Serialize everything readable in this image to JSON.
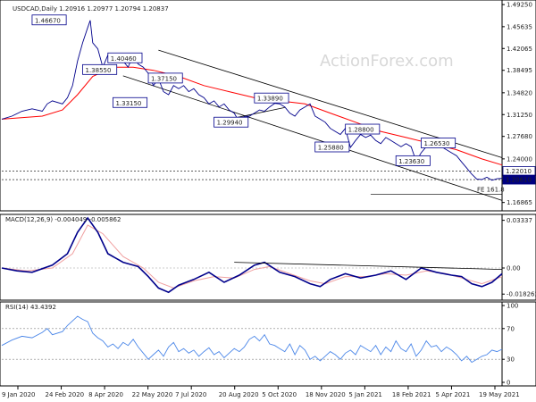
{
  "chart_data": [
    {
      "type": "line",
      "title": "USDCAD,Daily  1.20916 1.20977 1.20794 1.20837",
      "watermark": "ActionForex.com",
      "ylim": [
        1.155,
        1.5
      ],
      "y_ticks": [
        "1.49250",
        "1.45635",
        "1.42065",
        "1.38495",
        "1.34820",
        "1.31250",
        "1.27680",
        "1.24000",
        "1.20430",
        "1.16865"
      ],
      "x_labels": [
        "9 Jan 2020",
        "24 Feb 2020",
        "8 Apr 2020",
        "22 May 2020",
        "7 Jul 2020",
        "20 Aug 2020",
        "5 Oct 2020",
        "18 Nov 2020",
        "5 Jan 2021",
        "18 Feb 2021",
        "5 Apr 2021",
        "19 May 2021"
      ],
      "colors": {
        "price": "#00008b",
        "ma": "#ff0000",
        "channel": "#000000",
        "label_border": "#00008b",
        "label_fill": "#ffffff"
      },
      "price_series": [
        [
          0,
          1.305
        ],
        [
          2,
          1.31
        ],
        [
          4,
          1.318
        ],
        [
          6,
          1.322
        ],
        [
          8,
          1.318
        ],
        [
          9,
          1.33
        ],
        [
          10,
          1.335
        ],
        [
          12,
          1.33
        ],
        [
          13,
          1.34
        ],
        [
          14,
          1.36
        ],
        [
          15,
          1.4
        ],
        [
          16,
          1.43
        ],
        [
          17,
          1.455
        ],
        [
          17.5,
          1.4667
        ],
        [
          18,
          1.43
        ],
        [
          19,
          1.42
        ],
        [
          20,
          1.39
        ],
        [
          21,
          1.41
        ],
        [
          22,
          1.4
        ],
        [
          23,
          1.405
        ],
        [
          24,
          1.4
        ],
        [
          25,
          1.39
        ],
        [
          26,
          1.41
        ],
        [
          27,
          1.395
        ],
        [
          28,
          1.39
        ],
        [
          29,
          1.38
        ],
        [
          30,
          1.36
        ],
        [
          31,
          1.3715
        ],
        [
          32,
          1.35
        ],
        [
          33,
          1.345
        ],
        [
          34,
          1.36
        ],
        [
          35,
          1.355
        ],
        [
          36,
          1.36
        ],
        [
          37,
          1.35
        ],
        [
          38,
          1.355
        ],
        [
          39,
          1.345
        ],
        [
          40,
          1.34
        ],
        [
          41,
          1.33
        ],
        [
          42,
          1.335
        ],
        [
          43,
          1.325
        ],
        [
          44,
          1.33
        ],
        [
          45,
          1.32
        ],
        [
          46,
          1.315
        ],
        [
          47,
          1.3
        ],
        [
          48,
          1.3094
        ],
        [
          49,
          1.31
        ],
        [
          50,
          1.315
        ],
        [
          51,
          1.32
        ],
        [
          52,
          1.318
        ],
        [
          53,
          1.325
        ],
        [
          54,
          1.3309
        ],
        [
          55,
          1.33
        ],
        [
          56,
          1.325
        ],
        [
          57,
          1.315
        ],
        [
          58,
          1.31
        ],
        [
          59,
          1.32
        ],
        [
          60,
          1.325
        ],
        [
          61,
          1.33
        ],
        [
          62,
          1.31
        ],
        [
          63,
          1.305
        ],
        [
          64,
          1.3
        ],
        [
          65,
          1.29
        ],
        [
          66,
          1.285
        ],
        [
          67,
          1.28
        ],
        [
          68,
          1.29
        ],
        [
          69,
          1.2588
        ],
        [
          70,
          1.27
        ],
        [
          71,
          1.28
        ],
        [
          72,
          1.275
        ],
        [
          73,
          1.279
        ],
        [
          74,
          1.27
        ],
        [
          75,
          1.265
        ],
        [
          76,
          1.275
        ],
        [
          77,
          1.27
        ],
        [
          78,
          1.265
        ],
        [
          79,
          1.26
        ],
        [
          80,
          1.265
        ],
        [
          81,
          1.26
        ],
        [
          82,
          1.2363
        ],
        [
          83,
          1.25
        ],
        [
          84,
          1.26
        ],
        [
          85,
          1.27
        ],
        [
          86,
          1.2653
        ],
        [
          87,
          1.26
        ],
        [
          88,
          1.255
        ],
        [
          89,
          1.25
        ],
        [
          90,
          1.245
        ],
        [
          91,
          1.235
        ],
        [
          92,
          1.225
        ],
        [
          93,
          1.215
        ],
        [
          94,
          1.207
        ],
        [
          95,
          1.2061
        ],
        [
          96,
          1.21
        ],
        [
          97,
          1.205
        ],
        [
          98,
          1.2075
        ],
        [
          99,
          1.208
        ]
      ],
      "ma_series": [
        [
          0,
          1.305
        ],
        [
          8,
          1.31
        ],
        [
          12,
          1.32
        ],
        [
          15,
          1.345
        ],
        [
          18,
          1.375
        ],
        [
          22,
          1.39
        ],
        [
          26,
          1.39
        ],
        [
          30,
          1.385
        ],
        [
          35,
          1.375
        ],
        [
          40,
          1.36
        ],
        [
          45,
          1.35
        ],
        [
          50,
          1.34
        ],
        [
          55,
          1.335
        ],
        [
          60,
          1.33
        ],
        [
          65,
          1.315
        ],
        [
          70,
          1.3
        ],
        [
          75,
          1.285
        ],
        [
          80,
          1.275
        ],
        [
          85,
          1.265
        ],
        [
          90,
          1.255
        ],
        [
          95,
          1.24
        ],
        [
          99,
          1.23
        ]
      ],
      "horizontal_lines": [
        1.2201,
        1.2061
      ],
      "fe_line": {
        "value": 1.182,
        "label": "FE 161.8"
      },
      "price_labels": [
        {
          "text": "1.46670",
          "x": 6,
          "y": 1.4667
        },
        {
          "text": "1.38550",
          "x": 16,
          "y": 1.3855
        },
        {
          "text": "1.40460",
          "x": 21,
          "y": 1.4046
        },
        {
          "text": "1.37150",
          "x": 29,
          "y": 1.3715
        },
        {
          "text": "1.33150",
          "x": 22,
          "y": 1.3315
        },
        {
          "text": "1.29940",
          "x": 42,
          "y": 1.2994
        },
        {
          "text": "1.33890",
          "x": 50,
          "y": 1.3389
        },
        {
          "text": "1.28800",
          "x": 68,
          "y": 1.288
        },
        {
          "text": "1.25880",
          "x": 62,
          "y": 1.2588
        },
        {
          "text": "1.23630",
          "x": 78,
          "y": 1.2363
        },
        {
          "text": "1.26530",
          "x": 83,
          "y": 1.2653
        }
      ],
      "current_labels": [
        "1.22010",
        "1.20610"
      ]
    },
    {
      "type": "line",
      "title": "MACD(12,26,9) -0.004049 -0.005862",
      "ylim": [
        -0.02,
        0.035
      ],
      "y_ticks": [
        "0.03337",
        "0.00",
        "-0.018262"
      ],
      "macd_series": [
        [
          0,
          0.0
        ],
        [
          3,
          -0.002
        ],
        [
          6,
          -0.003
        ],
        [
          10,
          0.002
        ],
        [
          13,
          0.01
        ],
        [
          15,
          0.025
        ],
        [
          17,
          0.035
        ],
        [
          19,
          0.025
        ],
        [
          21,
          0.01
        ],
        [
          24,
          0.004
        ],
        [
          27,
          0.001
        ],
        [
          29,
          -0.006
        ],
        [
          31,
          -0.014
        ],
        [
          33,
          -0.017
        ],
        [
          35,
          -0.012
        ],
        [
          38,
          -0.008
        ],
        [
          41,
          -0.003
        ],
        [
          44,
          -0.01
        ],
        [
          47,
          -0.005
        ],
        [
          50,
          0.002
        ],
        [
          52,
          0.004
        ],
        [
          55,
          -0.003
        ],
        [
          58,
          -0.006
        ],
        [
          61,
          -0.011
        ],
        [
          63,
          -0.013
        ],
        [
          65,
          -0.008
        ],
        [
          68,
          -0.004
        ],
        [
          71,
          -0.007
        ],
        [
          74,
          -0.005
        ],
        [
          77,
          -0.002
        ],
        [
          80,
          -0.008
        ],
        [
          83,
          0.0
        ],
        [
          86,
          -0.003
        ],
        [
          89,
          -0.005
        ],
        [
          91,
          -0.006
        ],
        [
          93,
          -0.011
        ],
        [
          95,
          -0.013
        ],
        [
          97,
          -0.01
        ],
        [
          99,
          -0.004
        ]
      ],
      "signal_series": [
        [
          0,
          0.0
        ],
        [
          5,
          -0.002
        ],
        [
          10,
          0.0
        ],
        [
          14,
          0.01
        ],
        [
          17,
          0.03
        ],
        [
          20,
          0.024
        ],
        [
          24,
          0.008
        ],
        [
          28,
          0.0
        ],
        [
          31,
          -0.01
        ],
        [
          34,
          -0.014
        ],
        [
          38,
          -0.009
        ],
        [
          42,
          -0.006
        ],
        [
          46,
          -0.007
        ],
        [
          50,
          -0.001
        ],
        [
          53,
          0.001
        ],
        [
          57,
          -0.004
        ],
        [
          61,
          -0.009
        ],
        [
          64,
          -0.011
        ],
        [
          68,
          -0.006
        ],
        [
          72,
          -0.006
        ],
        [
          76,
          -0.004
        ],
        [
          80,
          -0.005
        ],
        [
          84,
          -0.002
        ],
        [
          88,
          -0.004
        ],
        [
          92,
          -0.008
        ],
        [
          95,
          -0.011
        ],
        [
          99,
          -0.006
        ]
      ],
      "trendline": [
        [
          46,
          0.004
        ],
        [
          99,
          -0.001
        ]
      ],
      "colors": {
        "macd": "#00008b",
        "signal": "#f0a0a0",
        "trendline": "#000000"
      }
    },
    {
      "type": "line",
      "title": "RSI(14) 43.4392",
      "ylim": [
        0,
        100
      ],
      "y_ticks": [
        "100",
        "70",
        "30",
        "0"
      ],
      "levels": [
        70,
        30
      ],
      "rsi_series": [
        [
          0,
          48
        ],
        [
          2,
          55
        ],
        [
          4,
          60
        ],
        [
          6,
          58
        ],
        [
          8,
          65
        ],
        [
          9,
          70
        ],
        [
          10,
          62
        ],
        [
          12,
          66
        ],
        [
          13,
          74
        ],
        [
          14,
          80
        ],
        [
          15,
          86
        ],
        [
          16,
          82
        ],
        [
          17,
          79
        ],
        [
          18,
          64
        ],
        [
          19,
          58
        ],
        [
          20,
          54
        ],
        [
          21,
          46
        ],
        [
          22,
          50
        ],
        [
          23,
          44
        ],
        [
          24,
          52
        ],
        [
          25,
          48
        ],
        [
          26,
          56
        ],
        [
          27,
          46
        ],
        [
          28,
          38
        ],
        [
          29,
          30
        ],
        [
          30,
          36
        ],
        [
          31,
          42
        ],
        [
          32,
          34
        ],
        [
          33,
          46
        ],
        [
          34,
          52
        ],
        [
          35,
          40
        ],
        [
          36,
          44
        ],
        [
          37,
          38
        ],
        [
          38,
          42
        ],
        [
          39,
          34
        ],
        [
          40,
          40
        ],
        [
          41,
          45
        ],
        [
          42,
          36
        ],
        [
          43,
          40
        ],
        [
          44,
          32
        ],
        [
          45,
          38
        ],
        [
          46,
          44
        ],
        [
          47,
          40
        ],
        [
          48,
          46
        ],
        [
          49,
          56
        ],
        [
          50,
          60
        ],
        [
          51,
          54
        ],
        [
          52,
          62
        ],
        [
          53,
          50
        ],
        [
          54,
          48
        ],
        [
          55,
          44
        ],
        [
          56,
          40
        ],
        [
          57,
          50
        ],
        [
          58,
          36
        ],
        [
          59,
          48
        ],
        [
          60,
          42
        ],
        [
          61,
          30
        ],
        [
          62,
          34
        ],
        [
          63,
          28
        ],
        [
          64,
          34
        ],
        [
          65,
          40
        ],
        [
          66,
          36
        ],
        [
          67,
          30
        ],
        [
          68,
          38
        ],
        [
          69,
          42
        ],
        [
          70,
          36
        ],
        [
          71,
          48
        ],
        [
          72,
          44
        ],
        [
          73,
          40
        ],
        [
          74,
          48
        ],
        [
          75,
          36
        ],
        [
          76,
          46
        ],
        [
          77,
          40
        ],
        [
          78,
          54
        ],
        [
          79,
          44
        ],
        [
          80,
          40
        ],
        [
          81,
          50
        ],
        [
          82,
          34
        ],
        [
          83,
          42
        ],
        [
          84,
          54
        ],
        [
          85,
          46
        ],
        [
          86,
          48
        ],
        [
          87,
          40
        ],
        [
          88,
          46
        ],
        [
          89,
          42
        ],
        [
          90,
          36
        ],
        [
          91,
          28
        ],
        [
          92,
          34
        ],
        [
          93,
          26
        ],
        [
          94,
          30
        ],
        [
          95,
          34
        ],
        [
          96,
          36
        ],
        [
          97,
          42
        ],
        [
          98,
          40
        ],
        [
          99,
          43
        ]
      ],
      "colors": {
        "rsi": "#4a86e8",
        "level": "#808080"
      }
    }
  ]
}
